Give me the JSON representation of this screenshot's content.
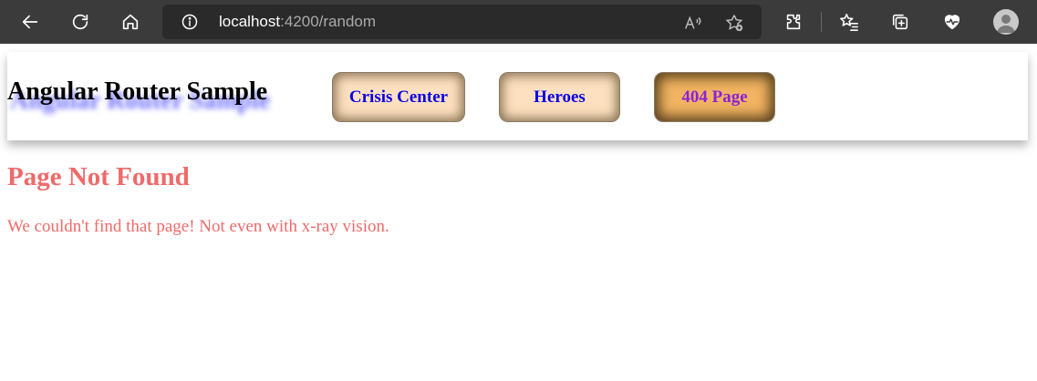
{
  "browser": {
    "url_host": "localhost",
    "url_path": ":4200/random",
    "icons": {
      "back": "back-arrow-icon",
      "refresh": "refresh-icon",
      "home": "home-icon",
      "info": "site-info-icon",
      "read_aloud": "read-aloud-icon",
      "favorite_add": "add-favorite-icon",
      "extensions": "extensions-icon",
      "favorites": "favorites-icon",
      "collections": "collections-icon",
      "health": "browser-essentials-icon",
      "profile": "profile-avatar-icon"
    }
  },
  "app": {
    "title": "Angular Router Sample",
    "nav": [
      {
        "label": "Crisis Center",
        "active": false
      },
      {
        "label": "Heroes",
        "active": false
      },
      {
        "label": "404 Page",
        "active": true
      }
    ]
  },
  "page": {
    "heading": "Page Not Found",
    "message": "We couldn't find that page! Not even with x-ray vision."
  },
  "colors": {
    "toolbar_bg": "#3b3b3b",
    "nav_bg": "#fde0bf",
    "nav_active_bg": "#f2b462",
    "nav_text": "#0a00e6",
    "nav_active_text": "#8a22d6",
    "error_text": "#ef6a6a"
  }
}
